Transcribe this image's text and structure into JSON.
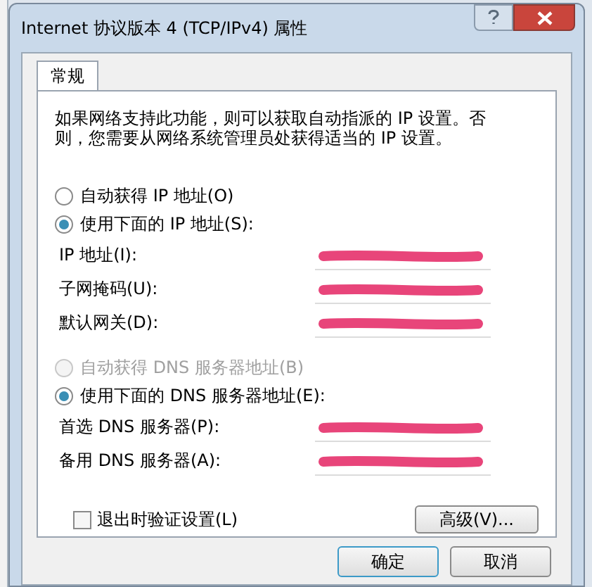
{
  "window": {
    "title": "Internet 协议版本 4 (TCP/IPv4) 属性"
  },
  "tabs": [
    {
      "label": "常规",
      "selected": true
    }
  ],
  "description": "如果网络支持此功能，则可以获取自动指派的 IP 设置。否则，您需要从网络系统管理员处获得适当的 IP 设置。",
  "ip_mode": [
    {
      "label": "自动获得 IP 地址(O)",
      "selected": false,
      "disabled": false
    },
    {
      "label": "使用下面的 IP 地址(S):",
      "selected": true,
      "disabled": false
    }
  ],
  "ip_fields": [
    {
      "label": "IP 地址(I):",
      "redacted": true
    },
    {
      "label": "子网掩码(U):",
      "redacted": true
    },
    {
      "label": "默认网关(D):",
      "redacted": true
    }
  ],
  "dns_mode": [
    {
      "label": "自动获得 DNS 服务器地址(B)",
      "selected": false,
      "disabled": true
    },
    {
      "label": "使用下面的 DNS 服务器地址(E):",
      "selected": true,
      "disabled": false
    }
  ],
  "dns_fields": [
    {
      "label": "首选 DNS 服务器(P):",
      "redacted": true
    },
    {
      "label": "备用 DNS 服务器(A):",
      "redacted": true
    }
  ],
  "validate": {
    "label": "退出时验证设置(L)",
    "checked": false
  },
  "advanced_button": "高级(V)...",
  "buttons": [
    "确定",
    "取消"
  ]
}
